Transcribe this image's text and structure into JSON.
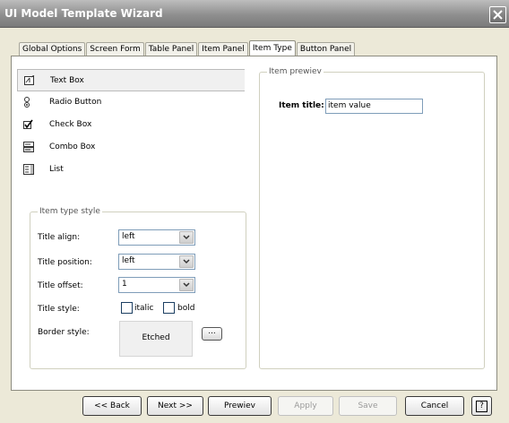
{
  "window": {
    "title": "UI Model Template Wizard",
    "close_symbol": "✕"
  },
  "tabs": [
    {
      "label": "Global Options",
      "active": false
    },
    {
      "label": "Screen Form",
      "active": false
    },
    {
      "label": "Table Panel",
      "active": false
    },
    {
      "label": "Item Panel",
      "active": false
    },
    {
      "label": "Item Type",
      "active": true
    },
    {
      "label": "Button Panel",
      "active": false
    }
  ],
  "item_types": [
    {
      "label": "Text Box",
      "icon": "text-box-icon",
      "selected": true
    },
    {
      "label": "Radio Button",
      "icon": "radio-button-icon",
      "selected": false
    },
    {
      "label": "Check Box",
      "icon": "check-box-icon",
      "selected": false
    },
    {
      "label": "Combo Box",
      "icon": "combo-box-icon",
      "selected": false
    },
    {
      "label": "List",
      "icon": "list-icon",
      "selected": false
    }
  ],
  "style_group": {
    "title": "Item type style",
    "title_align": {
      "label": "Title align:",
      "value": "left"
    },
    "title_position": {
      "label": "Title position:",
      "value": "left"
    },
    "title_offset": {
      "label": "Title offset:",
      "value": "1"
    },
    "title_style": {
      "label": "Title style:",
      "italic_label": "italic",
      "bold_label": "bold",
      "italic": false,
      "bold": false
    },
    "border_style": {
      "label": "Border style:",
      "value": "Etched",
      "browse_label": "..."
    }
  },
  "preview": {
    "title": "Item prewiev",
    "item_title": "Item title:",
    "item_value": "item value"
  },
  "buttons": {
    "back": "<< Back",
    "next": "Next >>",
    "preview": "Prewiev",
    "apply": "Apply",
    "save": "Save",
    "cancel": "Cancel",
    "help": "?"
  }
}
